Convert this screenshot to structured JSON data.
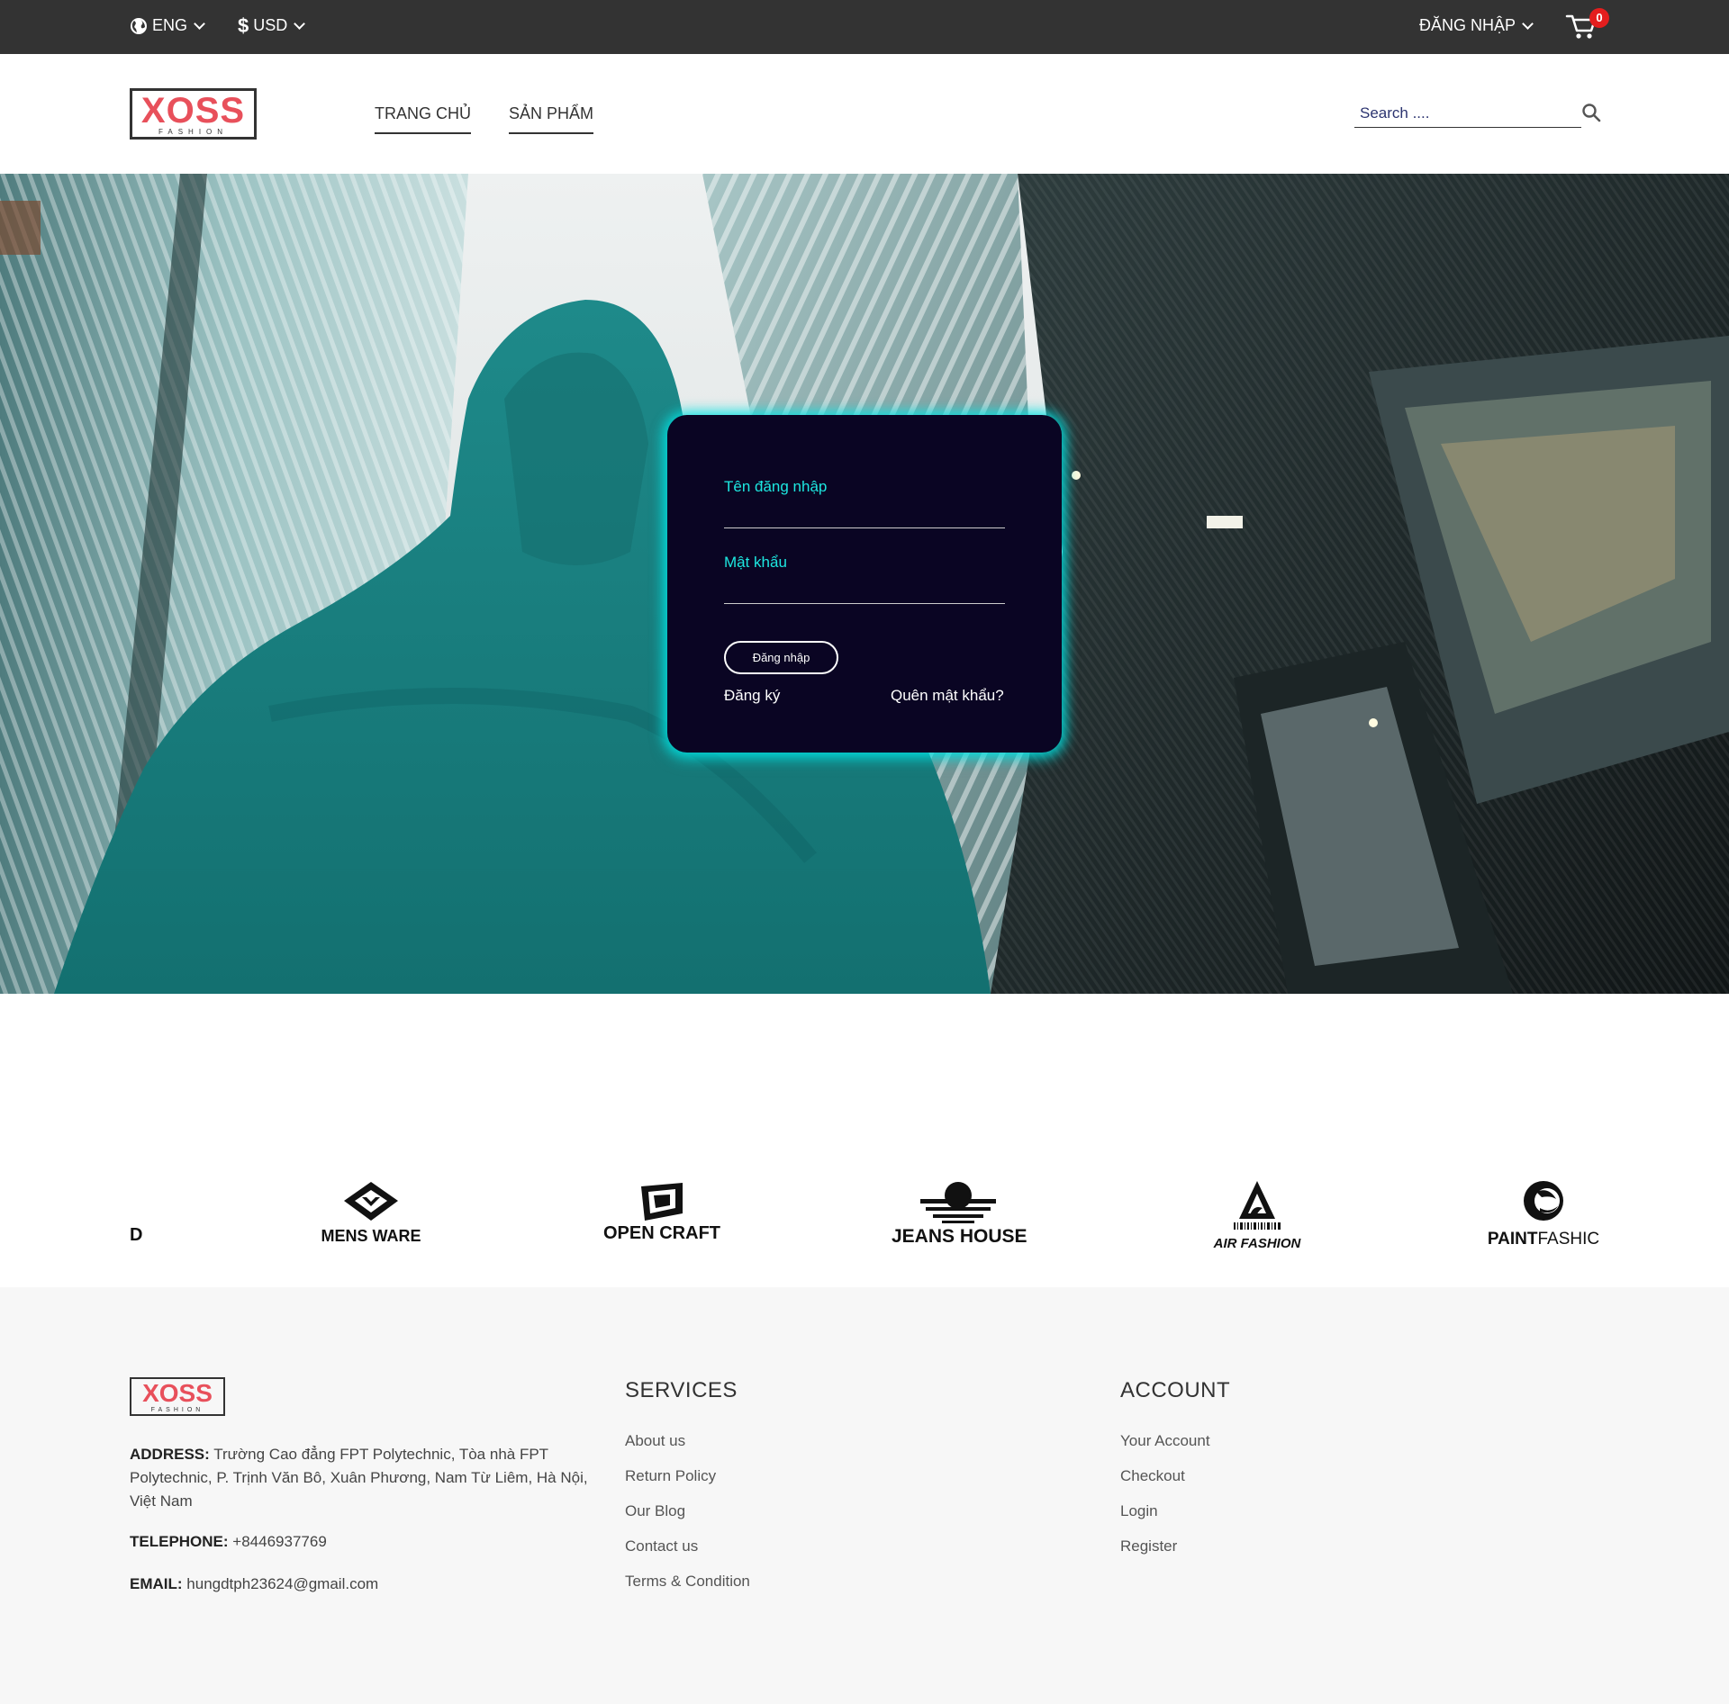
{
  "topbar": {
    "language": "ENG",
    "currency": "USD",
    "login_label": "ĐĂNG NHẬP",
    "cart_count": "0",
    "icons": [
      "globe-icon",
      "dollar-icon",
      "chevron-down-icon",
      "cart-icon"
    ]
  },
  "header": {
    "logo_text": "XOSS",
    "logo_subtext": "FASHION",
    "nav": [
      "TRANG CHỦ",
      "SẢN PHẨM"
    ],
    "search_placeholder": "Search ...."
  },
  "login_form": {
    "username_label": "Tên đăng nhập",
    "password_label": "Mật khẩu",
    "submit_label": "Đăng nhập",
    "register_label": "Đăng ký",
    "forgot_label": "Quên mật khẩu?",
    "accent_color": "#1de7e0",
    "card_color": "#0a0523"
  },
  "brands": {
    "partial": "D",
    "mensware": "MENS WARE",
    "opencraft": "OPEN CRAFT",
    "jeanshouse": "JEANS HOUSE",
    "airfashion": "AIR FASHION",
    "paint": "PAINT",
    "fashic": "FASHIC"
  },
  "footer": {
    "logo_text": "XOSS",
    "logo_subtext": "FASHION",
    "address_label": "ADDRESS:",
    "address_value": "Trường Cao đẳng FPT Polytechnic, Tòa nhà FPT Polytechnic, P. Trịnh Văn Bô, Xuân Phương, Nam Từ Liêm, Hà Nội, Việt Nam",
    "telephone_label": "TELEPHONE:",
    "telephone_value": "+8446937769",
    "email_label": "EMAIL:",
    "email_value": "hungdtph23624@gmail.com",
    "services_heading": "SERVICES",
    "services": [
      "About us",
      "Return Policy",
      "Our Blog",
      "Contact us",
      "Terms & Condition"
    ],
    "account_heading": "ACCOUNT",
    "account": [
      "Your Account",
      "Checkout",
      "Login",
      "Register"
    ]
  },
  "colors": {
    "topbar_bg": "#333333",
    "logo_red": "#e8505b",
    "badge_red": "#e41e1e",
    "footer_bg": "#f7f7f7"
  }
}
